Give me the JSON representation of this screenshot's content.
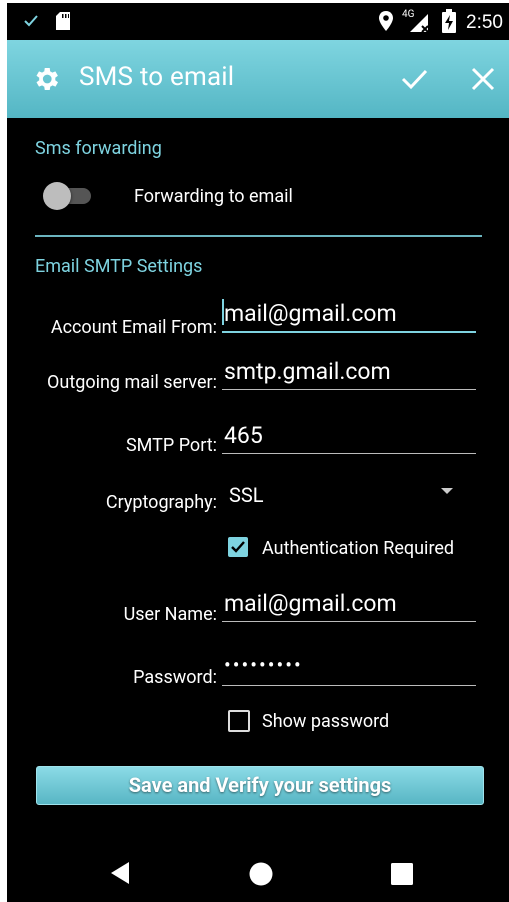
{
  "status_bar": {
    "time": "2:50",
    "network": "4G",
    "icons": [
      "check-icon",
      "sd-card-icon",
      "location-pin-icon",
      "signal-icon",
      "battery-charging-icon"
    ]
  },
  "action_bar": {
    "title": "SMS to email",
    "icons": [
      "gear-icon",
      "check-icon",
      "close-icon"
    ],
    "color": "#66c4d1"
  },
  "sections": {
    "forwarding_title": "Sms forwarding",
    "smtp_title": "Email SMTP Settings"
  },
  "forwarding": {
    "label": "Forwarding to email",
    "enabled": false
  },
  "smtp": {
    "account_label": "Account Email From:",
    "account_value": "mail@gmail.com",
    "server_label": "Outgoing mail server:",
    "server_value": "smtp.gmail.com",
    "port_label": "SMTP Port:",
    "port_value": "465",
    "crypto_label": "Cryptography:",
    "crypto_value": "SSL",
    "auth_label": "Authentication Required",
    "auth_checked": true,
    "user_label": "User Name:",
    "user_value": "mail@gmail.com",
    "password_label": "Password:",
    "password_value": "•••••••••",
    "show_password_label": "Show password",
    "show_password_checked": false
  },
  "save_button": "Save and Verify your settings",
  "nav": [
    "back-icon",
    "home-icon",
    "recents-icon"
  ],
  "accent_color": "#7ed3e0"
}
